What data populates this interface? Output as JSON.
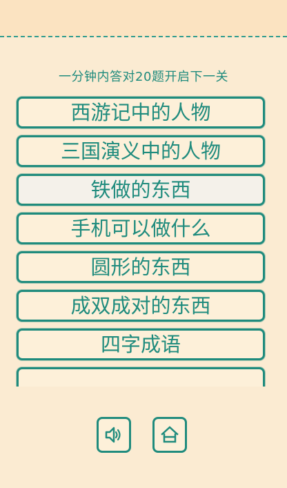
{
  "header": {
    "subtitle": "一分钟内答对20题开启下一关"
  },
  "levels": [
    {
      "label": "西游记中的人物",
      "selected": false
    },
    {
      "label": "三国演义中的人物",
      "selected": false
    },
    {
      "label": "铁做的东西",
      "selected": true
    },
    {
      "label": "手机可以做什么",
      "selected": false
    },
    {
      "label": "圆形的东西",
      "selected": false
    },
    {
      "label": "成双成对的东西",
      "selected": false
    },
    {
      "label": "四字成语",
      "selected": false
    }
  ],
  "controls": {
    "sound_icon": "speaker-icon",
    "home_icon": "home-icon"
  },
  "colors": {
    "background": "#fbebd2",
    "accent": "#1f8b7d",
    "selected_bg": "#f4f1ea"
  }
}
